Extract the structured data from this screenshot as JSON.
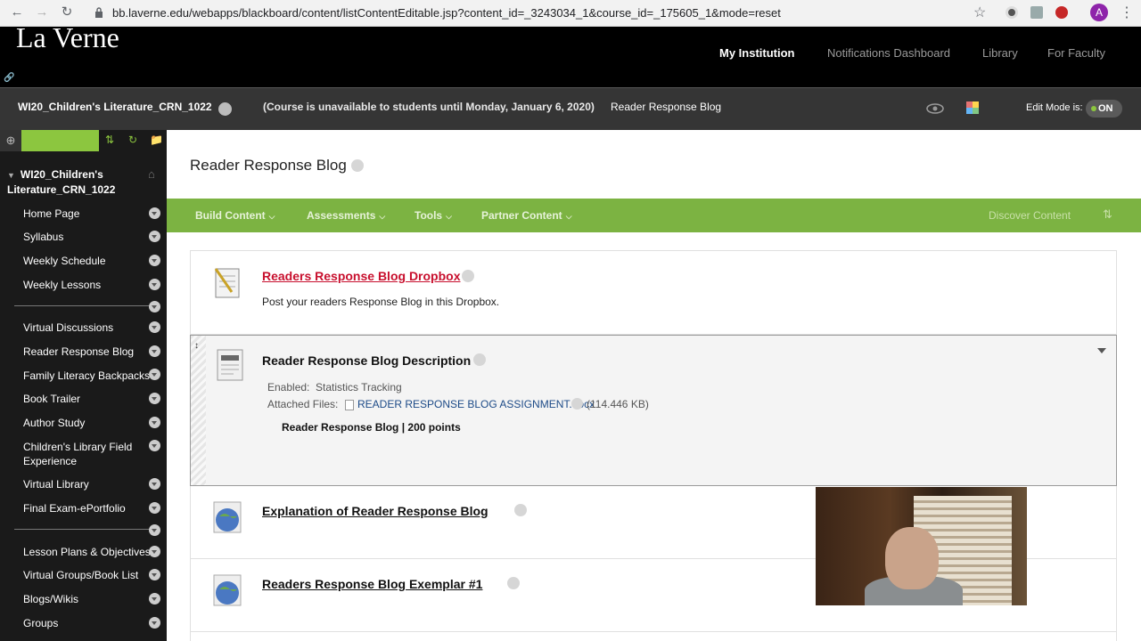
{
  "browser": {
    "url": "bb.laverne.edu/webapps/blackboard/content/listContentEditable.jsp?content_id=_3243034_1&course_id=_175605_1&mode=reset",
    "avatar_letter": "A"
  },
  "header": {
    "logo": "La Verne",
    "nav": [
      "My Institution",
      "Notifications Dashboard",
      "Library",
      "For Faculty"
    ]
  },
  "coursebar": {
    "course_name": "WI20_Children's Literature_CRN_1022",
    "unavailable": "(Course is unavailable to students until Monday, January 6, 2020)",
    "breadcrumb": "Reader Response Blog",
    "edit_mode_label": "Edit Mode is:",
    "edit_mode_value": "ON"
  },
  "sidebar": {
    "course_title": "WI20_Children's Literature_CRN_1022",
    "items": [
      "Home Page",
      "Syllabus",
      "Weekly Schedule",
      "Weekly Lessons",
      "Virtual Discussions",
      "Reader Response Blog",
      "Family Literacy Backpacks",
      "Book Trailer",
      "Author Study",
      "Children's Library Field Experience",
      "Virtual Library",
      "Final Exam-ePortfolio",
      "Lesson Plans & Objectives",
      "Virtual Groups/Book List",
      "Blogs/Wikis",
      "Groups"
    ]
  },
  "page": {
    "title": "Reader Response Blog",
    "actions": [
      "Build Content",
      "Assessments",
      "Tools",
      "Partner Content"
    ],
    "discover": "Discover Content"
  },
  "content": [
    {
      "title": "Readers Response Blog Dropbox",
      "description": "Post your readers Response Blog in this Dropbox.",
      "icon": "assignment-icon"
    },
    {
      "title": "Reader Response Blog Description",
      "enabled_label": "Enabled:",
      "enabled_value": "Statistics Tracking",
      "attached_label": "Attached Files:",
      "file_name": "READER RESPONSE BLOG ASSIGNMENT.docx",
      "file_size": "(114.446 KB)",
      "points_text": "Reader Response Blog | 200 points",
      "icon": "document-icon"
    },
    {
      "title": "Explanation of Reader Response Blog",
      "icon": "globe-icon"
    },
    {
      "title": "Readers Response Blog Exemplar #1",
      "icon": "globe-icon"
    }
  ],
  "colors": {
    "accent_green": "#7cb342",
    "link_red": "#c8102e",
    "header_black": "#000000",
    "sidebar_dark": "#1a1a1a"
  }
}
